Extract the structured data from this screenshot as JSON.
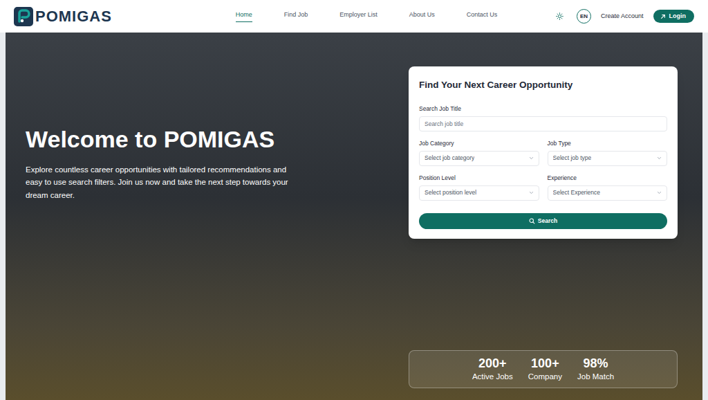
{
  "logo": {
    "text": "POMIGAS"
  },
  "nav": [
    {
      "label": "Home",
      "selected": true
    },
    {
      "label": "Find Job",
      "selected": false
    },
    {
      "label": "Employer List",
      "selected": false
    },
    {
      "label": "About Us",
      "selected": false
    },
    {
      "label": "Contact Us",
      "selected": false
    }
  ],
  "header_actions": {
    "language": "EN",
    "create_account": "Create Account",
    "login": "Login"
  },
  "hero": {
    "title": "Welcome to POMIGAS",
    "description": "Explore countless career opportunities with tailored recommendations and easy to use search filters. Join us now and take the next step towards your dream career."
  },
  "search_form": {
    "title": "Find Your Next Career Opportunity",
    "fields": [
      {
        "label": "Search Job Title",
        "placeholder": "Search job title",
        "kind": "text"
      },
      {
        "label": "Job Category",
        "placeholder": "Select job category",
        "kind": "select"
      },
      {
        "label": "Job Type",
        "placeholder": "Select job type",
        "kind": "select"
      },
      {
        "label": "Position Level",
        "placeholder": "Select position level",
        "kind": "select"
      },
      {
        "label": "Experience",
        "placeholder": "Select Experience",
        "kind": "select"
      }
    ],
    "button": "Search"
  },
  "stats": [
    {
      "value": "200+",
      "label": "Active Jobs"
    },
    {
      "value": "100+",
      "label": "Company"
    },
    {
      "value": "98%",
      "label": "Job Match"
    }
  ]
}
